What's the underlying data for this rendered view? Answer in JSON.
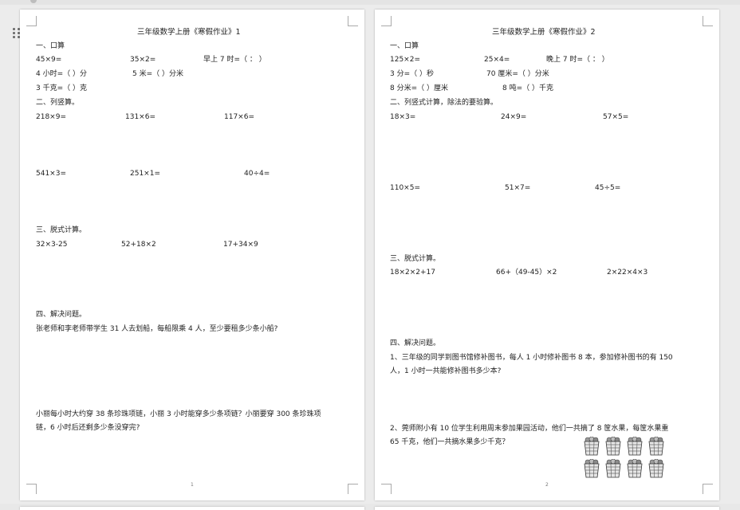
{
  "pages": [
    {
      "title": "三年级数学上册《寒假作业》1",
      "page_number": "1",
      "lines": [
        "一、口算",
        "45×9=",
        "35×2=",
        "早上 7 时=（          ：          ）",
        "4 小时=（          ）分",
        "5 米=（          ）分米",
        "3 千克=（          ）克",
        "二、列竖算。",
        "218×9=",
        "131×6=",
        "117×6=",
        "541×3=",
        "251×1=",
        "40÷4=",
        "三、脱式计算。",
        "32×3-25",
        "52+18×2",
        "17+34×9",
        "四、解决问题。",
        "张老师和李老师带学生 31 人去划船，每船限乘 4 人，至少要租多少条小船?",
        "小丽每小时大约穿 38 条珍珠项链，小丽 3 小时能穿多少条项链？小丽要穿 300 条珍珠项",
        "链，6 小时后还剩多少条没穿完?"
      ]
    },
    {
      "title": "三年级数学上册《寒假作业》2",
      "page_number": "2",
      "lines": [
        "一、口算",
        "125×2=",
        "25×4=",
        "晚上 7 时=（          ：          ）",
        "3 分=（          ）秒",
        "70 厘米=（          ）分米",
        "8 分米=（          ）厘米",
        "8 吨=（          ）千克",
        "二、列竖式计算，除法的要验算。",
        "18×3=",
        "24×9=",
        "57×5=",
        "110×5=",
        "51×7=",
        "45÷5=",
        "三、脱式计算。",
        "18×2×2+17",
        "66+（49-45）×2",
        "2×22×4×3",
        "四、解决问题。",
        "1、三年级的同学到图书馆修补图书，每人 1 小时修补图书 8 本，参加修补图书的有 150",
        "人，1 小时一共能修补图书多少本?",
        "2、莞师附小有 10 位学生利用周末参加果园活动，他们一共摘了 8 筐水果，每筐水果重",
        "65 千克，他们一共摘水果多少千克？"
      ],
      "fruit_basket_count": 8
    }
  ]
}
